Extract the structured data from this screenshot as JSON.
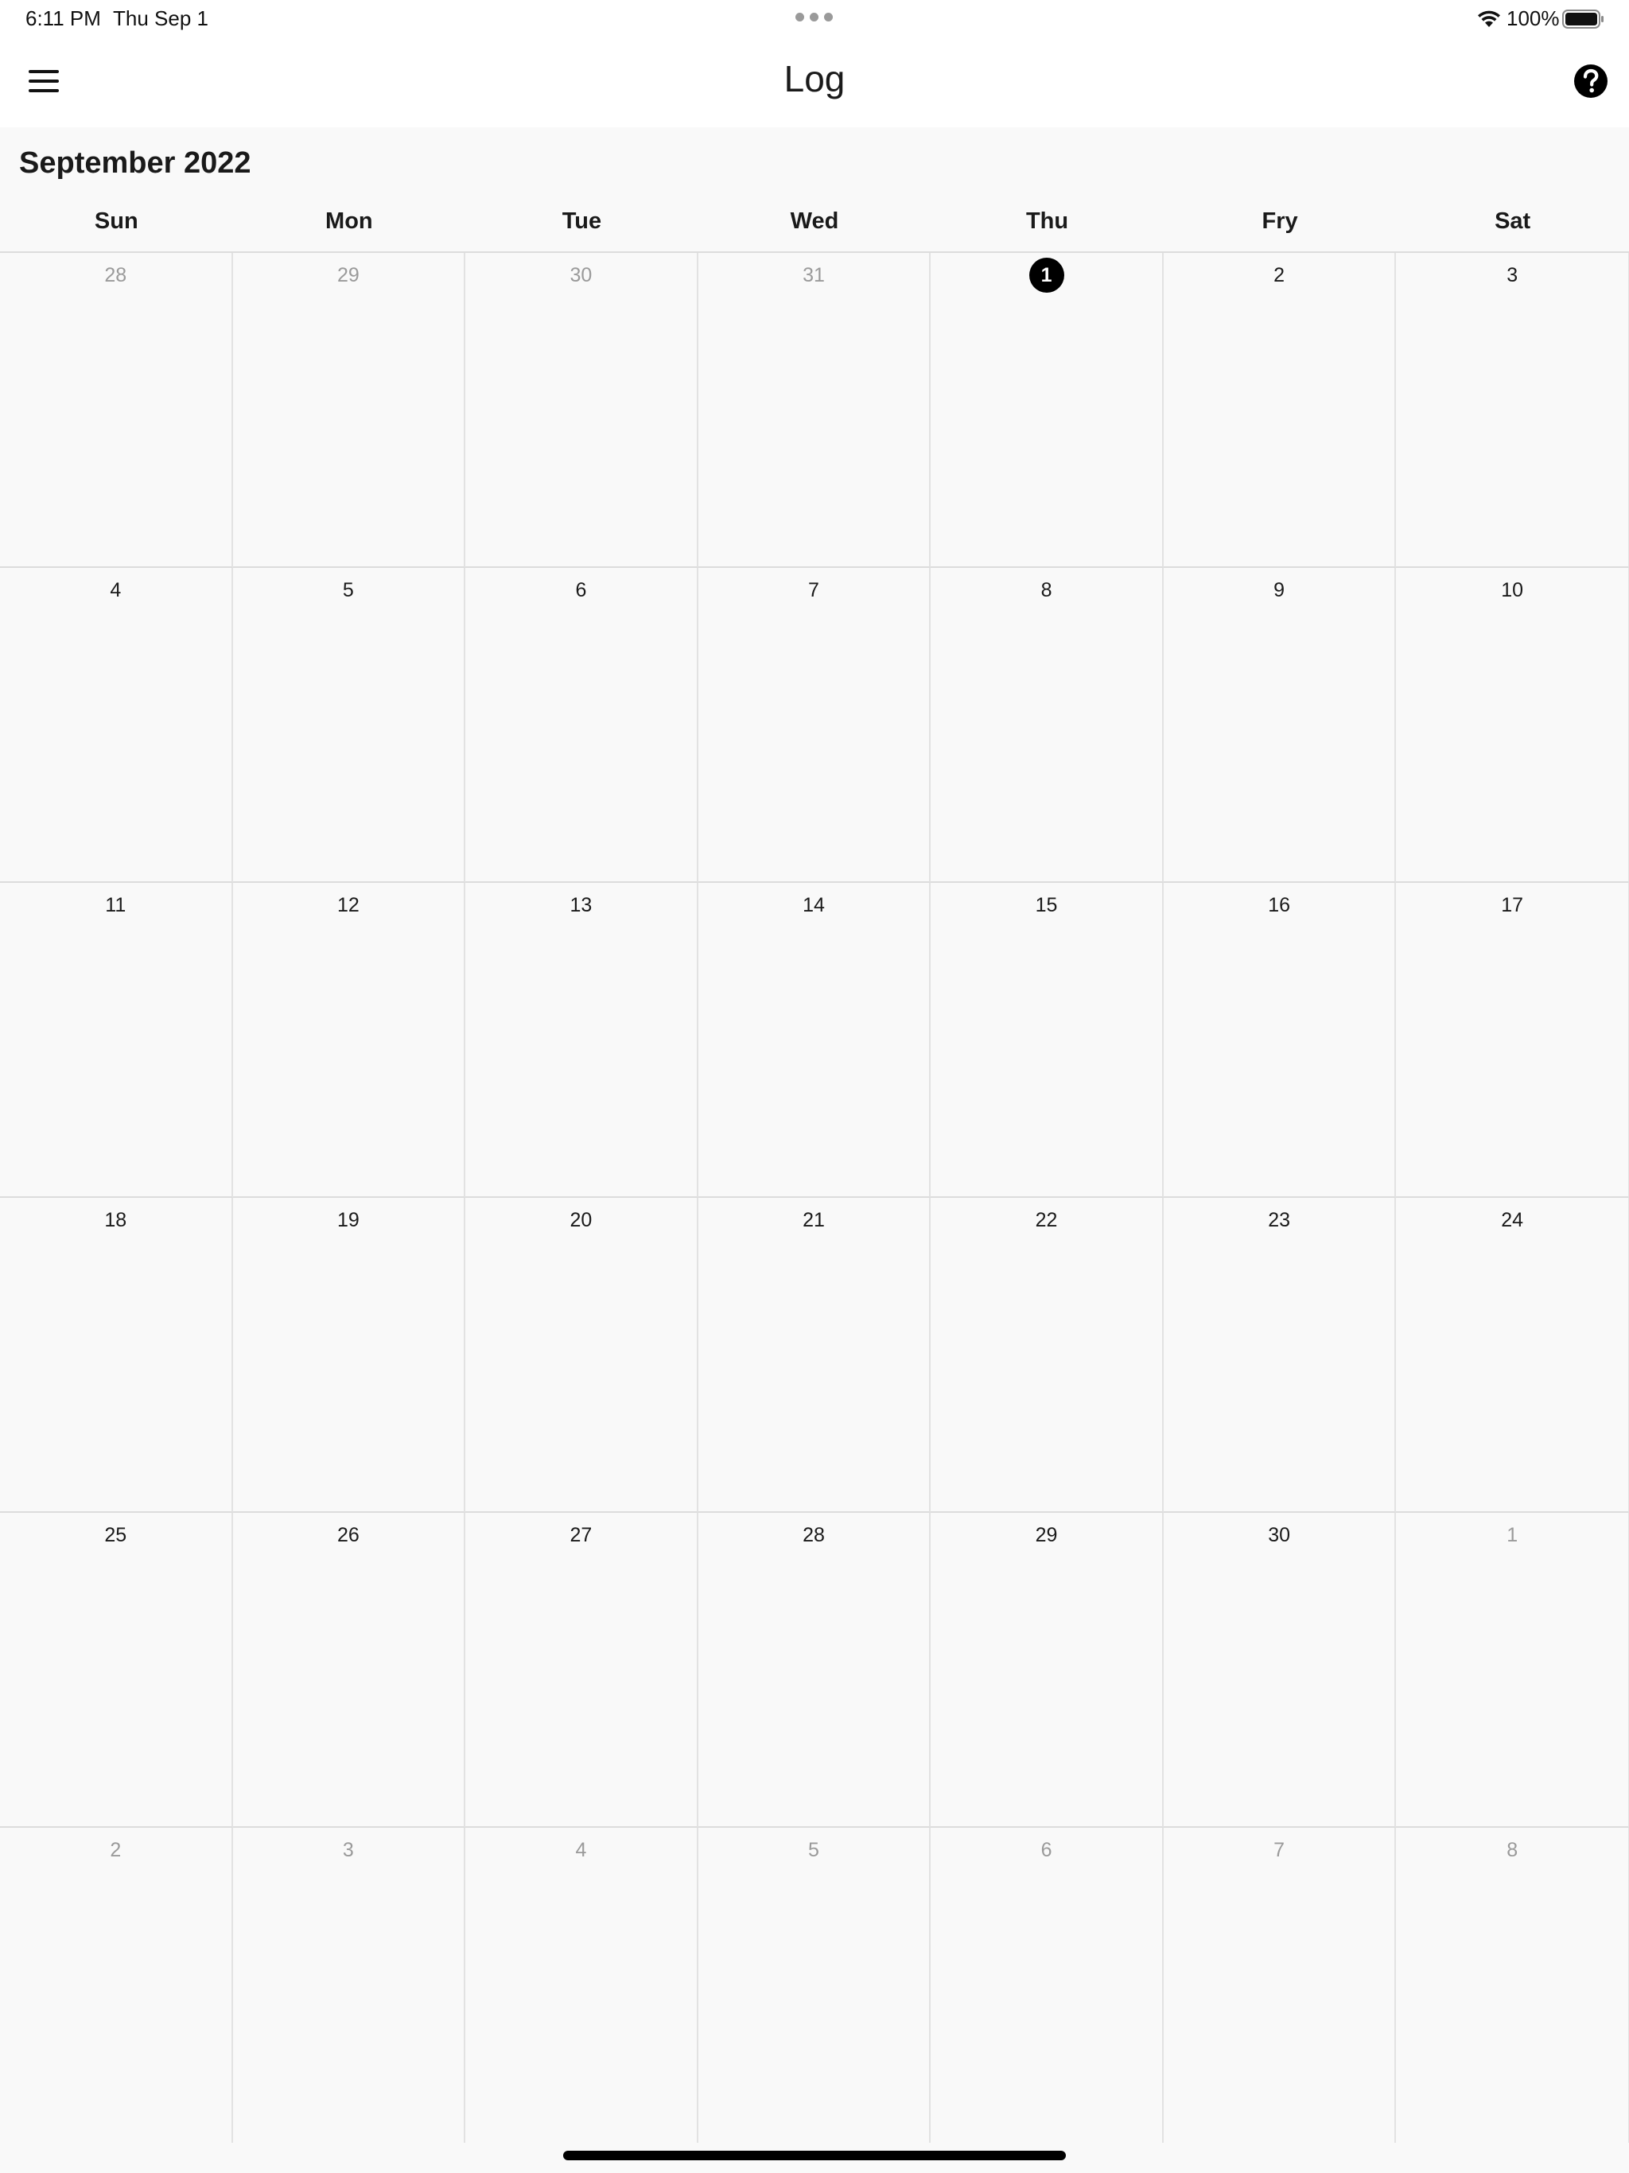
{
  "status_bar": {
    "time": "6:11 PM",
    "date": "Thu Sep 1",
    "battery_percent": "100%",
    "icons": [
      "multitask-dots-icon",
      "wifi-icon",
      "battery-icon"
    ]
  },
  "navbar": {
    "title": "Log",
    "menu_icon": "hamburger-menu-icon",
    "help_icon": "help-circle-icon"
  },
  "calendar": {
    "month_title": "September 2022",
    "weekdays": [
      "Sun",
      "Mon",
      "Tue",
      "Wed",
      "Thu",
      "Fry",
      "Sat"
    ],
    "today": "1",
    "colors": {
      "today_marker": "#000000",
      "outside_month_text": "#9a9a9a",
      "grid_line": "#dcdcdc",
      "background": "#f9f9f9"
    },
    "weeks": [
      [
        {
          "day": "28",
          "outside": true
        },
        {
          "day": "29",
          "outside": true
        },
        {
          "day": "30",
          "outside": true
        },
        {
          "day": "31",
          "outside": true
        },
        {
          "day": "1",
          "today": true
        },
        {
          "day": "2"
        },
        {
          "day": "3"
        }
      ],
      [
        {
          "day": "4"
        },
        {
          "day": "5"
        },
        {
          "day": "6"
        },
        {
          "day": "7"
        },
        {
          "day": "8"
        },
        {
          "day": "9"
        },
        {
          "day": "10"
        }
      ],
      [
        {
          "day": "11"
        },
        {
          "day": "12"
        },
        {
          "day": "13"
        },
        {
          "day": "14"
        },
        {
          "day": "15"
        },
        {
          "day": "16"
        },
        {
          "day": "17"
        }
      ],
      [
        {
          "day": "18"
        },
        {
          "day": "19"
        },
        {
          "day": "20"
        },
        {
          "day": "21"
        },
        {
          "day": "22"
        },
        {
          "day": "23"
        },
        {
          "day": "24"
        }
      ],
      [
        {
          "day": "25"
        },
        {
          "day": "26"
        },
        {
          "day": "27"
        },
        {
          "day": "28"
        },
        {
          "day": "29"
        },
        {
          "day": "30"
        },
        {
          "day": "1",
          "outside": true
        }
      ],
      [
        {
          "day": "2",
          "outside": true
        },
        {
          "day": "3",
          "outside": true
        },
        {
          "day": "4",
          "outside": true
        },
        {
          "day": "5",
          "outside": true
        },
        {
          "day": "6",
          "outside": true
        },
        {
          "day": "7",
          "outside": true
        },
        {
          "day": "8",
          "outside": true
        }
      ]
    ]
  }
}
